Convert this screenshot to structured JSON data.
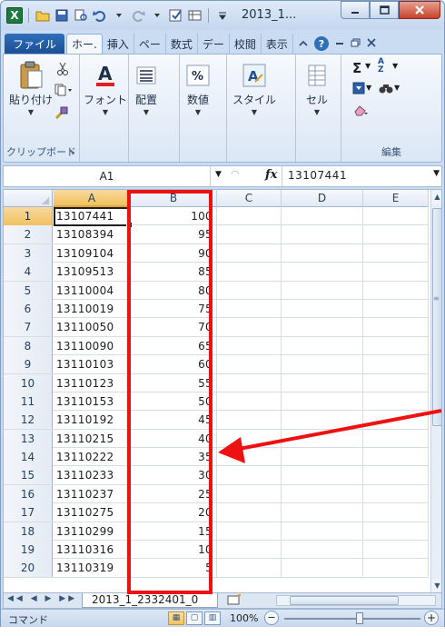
{
  "title_bar": {
    "title": "2013_1...",
    "app_icon_glyph": "X"
  },
  "tabs": {
    "file": "ファイル",
    "items": [
      "ホー.",
      "挿入",
      "ペー",
      "数式",
      "デー",
      "校閲",
      "表示"
    ]
  },
  "ribbon": {
    "paste": "貼り付け",
    "font": "フォント",
    "alignment": "配置",
    "number": "数値",
    "style": "スタイル",
    "cells": "セル",
    "clipboard_group": "クリップボード",
    "editing_group": "編集",
    "font_icon_glyph": "A",
    "number_icon_glyph": "%",
    "style_icon_glyph": "A",
    "sum_glyph": "Σ",
    "sort_glyph": "A Z"
  },
  "formula_bar": {
    "name_box": "A1",
    "fx_label": "fx",
    "value": "13107441"
  },
  "columns": [
    "A",
    "B",
    "C",
    "D",
    "E"
  ],
  "rows": [
    {
      "n": "1",
      "a": "13107441",
      "b": "100"
    },
    {
      "n": "2",
      "a": "13108394",
      "b": "95"
    },
    {
      "n": "3",
      "a": "13109104",
      "b": "90"
    },
    {
      "n": "4",
      "a": "13109513",
      "b": "85"
    },
    {
      "n": "5",
      "a": "13110004",
      "b": "80"
    },
    {
      "n": "6",
      "a": "13110019",
      "b": "75"
    },
    {
      "n": "7",
      "a": "13110050",
      "b": "70"
    },
    {
      "n": "8",
      "a": "13110090",
      "b": "65"
    },
    {
      "n": "9",
      "a": "13110103",
      "b": "60"
    },
    {
      "n": "10",
      "a": "13110123",
      "b": "55"
    },
    {
      "n": "11",
      "a": "13110153",
      "b": "50"
    },
    {
      "n": "12",
      "a": "13110192",
      "b": "45"
    },
    {
      "n": "13",
      "a": "13110215",
      "b": "40"
    },
    {
      "n": "14",
      "a": "13110222",
      "b": "35"
    },
    {
      "n": "15",
      "a": "13110233",
      "b": "30"
    },
    {
      "n": "16",
      "a": "13110237",
      "b": "25"
    },
    {
      "n": "17",
      "a": "13110275",
      "b": "20"
    },
    {
      "n": "18",
      "a": "13110299",
      "b": "15"
    },
    {
      "n": "19",
      "a": "13110316",
      "b": "10"
    },
    {
      "n": "20",
      "a": "13110319",
      "b": "5"
    }
  ],
  "sheet_tab": "2013_1_2332401_0",
  "status": {
    "mode": "コマンド",
    "zoom": "100%"
  },
  "colors": {
    "annotation": "#ee1111",
    "selected_header": "#f1c15f"
  }
}
